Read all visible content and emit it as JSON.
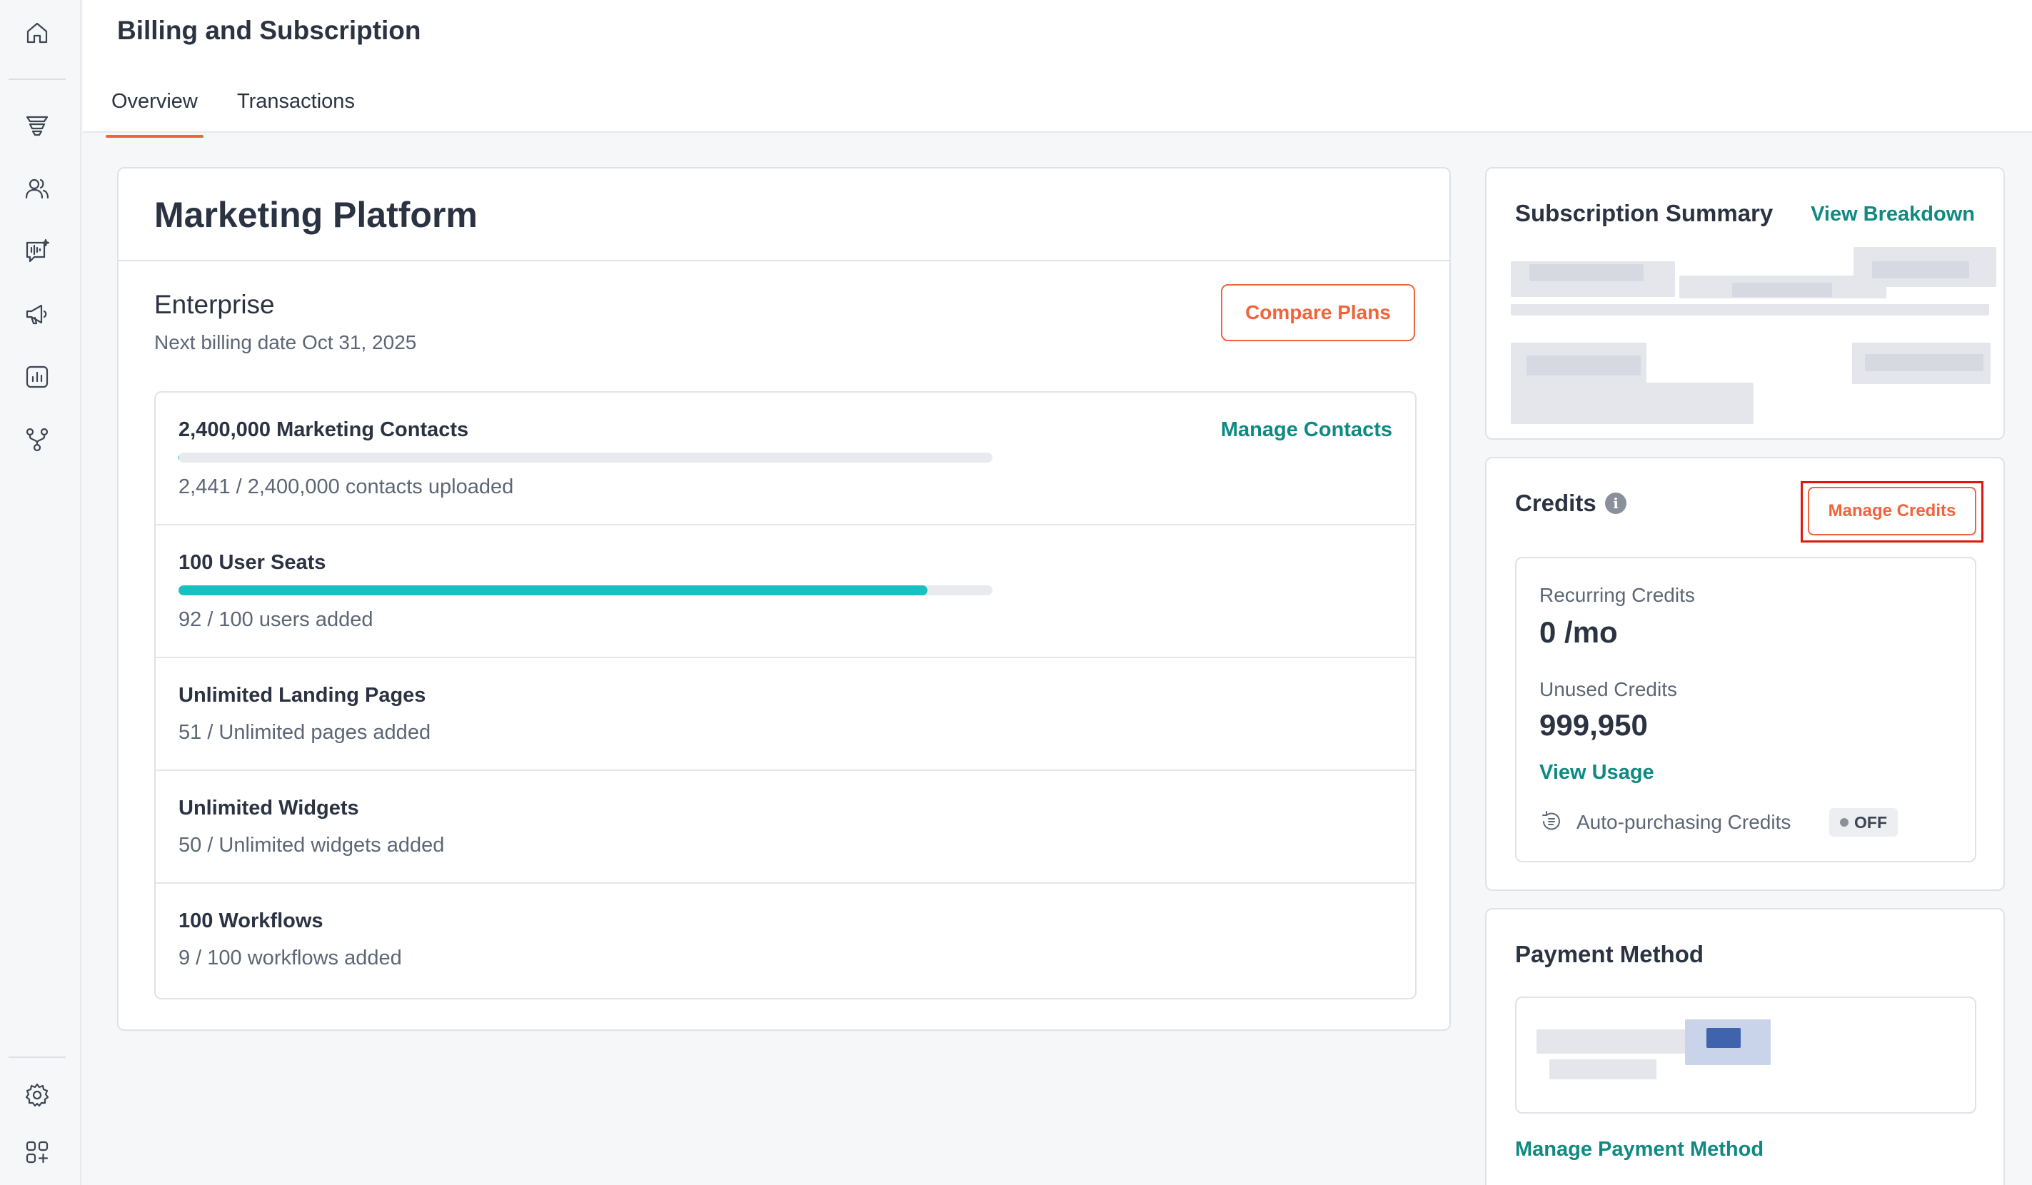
{
  "header": {
    "title": "Billing and Subscription",
    "tabs": [
      {
        "label": "Overview",
        "active": true
      },
      {
        "label": "Transactions",
        "active": false
      }
    ]
  },
  "sidebar": {
    "items": [
      {
        "icon": "home-icon"
      },
      {
        "icon": "funnel-icon"
      },
      {
        "icon": "contacts-icon"
      },
      {
        "icon": "voice-chat-icon"
      },
      {
        "icon": "megaphone-icon"
      },
      {
        "icon": "reports-icon"
      },
      {
        "icon": "workflow-icon"
      },
      {
        "icon": "settings-icon"
      },
      {
        "icon": "apps-icon"
      }
    ]
  },
  "plan_card": {
    "title": "Marketing Platform",
    "plan_name": "Enterprise",
    "billing": "Next billing date Oct 31, 2025",
    "compare_label": "Compare Plans",
    "usage": [
      {
        "title": "2,400,000 Marketing Contacts",
        "sub": "2,441 / 2,400,000 contacts uploaded",
        "link": "Manage Contacts",
        "progress": 0.001
      },
      {
        "title": "100 User Seats",
        "sub": "92 / 100 users added",
        "progress": 0.92
      },
      {
        "title": "Unlimited Landing Pages",
        "sub": "51 / Unlimited pages added"
      },
      {
        "title": "Unlimited Widgets",
        "sub": "50 / Unlimited widgets added"
      },
      {
        "title": "100 Workflows",
        "sub": "9 / 100 workflows added"
      }
    ]
  },
  "subscription_summary": {
    "title": "Subscription Summary",
    "link": "View Breakdown"
  },
  "credits": {
    "title": "Credits",
    "info": "i",
    "manage_label": "Manage Credits",
    "recurring_label": "Recurring Credits",
    "recurring_value": "0 /mo",
    "unused_label": "Unused Credits",
    "unused_value": "999,950",
    "view_usage": "View Usage",
    "auto_label": "Auto-purchasing Credits",
    "auto_state": "OFF"
  },
  "payment": {
    "title": "Payment Method",
    "manage_label": "Manage Payment Method"
  },
  "colors": {
    "accent": "#f0643c",
    "link": "#0f8a82",
    "progress": "#17c1c1",
    "highlight": "#e0180c"
  }
}
